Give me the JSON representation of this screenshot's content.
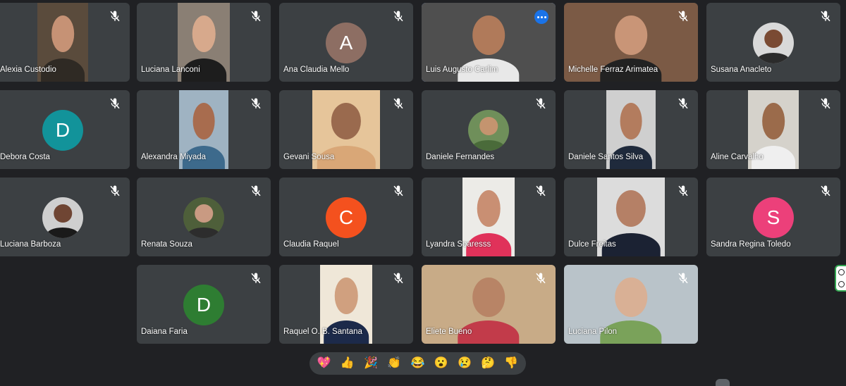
{
  "participants": [
    {
      "name": "Alexia Custodio",
      "kind": "video",
      "skin": "#c69275",
      "shirt": "#2f2a24",
      "bg": "#5a4b3c"
    },
    {
      "name": "Luciana Lanconi",
      "kind": "video",
      "skin": "#d7a98c",
      "shirt": "#1d1d1d",
      "bg": "#8a7f74"
    },
    {
      "name": "Ana Claudia Mello",
      "kind": "initial",
      "initial": "A",
      "color": "#8d6e63"
    },
    {
      "name": "Luis Augusto Carlim",
      "kind": "video",
      "skin": "#b07a5a",
      "shirt": "#e8e8e8",
      "bg": "#4f4f4f",
      "active": true
    },
    {
      "name": "Michelle Ferraz Arimatea",
      "kind": "video",
      "skin": "#c99577",
      "shirt": "#222",
      "bg": "#7b5a45"
    },
    {
      "name": "Susana Anacleto",
      "kind": "photo",
      "skin": "#7a4a33",
      "shirt": "#2b2b2b",
      "bg": "#d9d9d9"
    },
    {
      "name": "Debora Costa",
      "kind": "initial",
      "initial": "D",
      "color": "#12939a"
    },
    {
      "name": "Alexandra Miyada",
      "kind": "video",
      "skin": "#a86c4e",
      "shirt": "#3d6a8c",
      "bg": "#9fb3c2"
    },
    {
      "name": "Gevani Sousa",
      "kind": "video",
      "skin": "#9a6a4e",
      "shirt": "#d9a777",
      "bg": "#e6c59a"
    },
    {
      "name": "Daniele Fernandes",
      "kind": "photo",
      "skin": "#c4946f",
      "shirt": "#4a6b3a",
      "bg": "#6f8f5a"
    },
    {
      "name": "Daniele Santos Silva",
      "kind": "video",
      "skin": "#b37c5e",
      "shirt": "#1f2a3c",
      "bg": "#cfcfcf"
    },
    {
      "name": "Aline Carvalho",
      "kind": "video",
      "skin": "#9b6b4b",
      "shirt": "#efefef",
      "bg": "#d5d2cb"
    },
    {
      "name": "Luciana Barboza",
      "kind": "photo",
      "skin": "#6f4533",
      "shirt": "#1a1a1a",
      "bg": "#cfcfcf"
    },
    {
      "name": "Renata Souza",
      "kind": "photo",
      "skin": "#c99a82",
      "shirt": "#2d2d2d",
      "bg": "#4e5f3a"
    },
    {
      "name": "Claudia Raquel",
      "kind": "initial",
      "initial": "C",
      "color": "#f4511e"
    },
    {
      "name": "Lyandra Soaresss",
      "kind": "video",
      "skin": "#c98f73",
      "shirt": "#e0325a",
      "bg": "#ecebe7"
    },
    {
      "name": "Dulce Freitas",
      "kind": "video",
      "skin": "#b58066",
      "shirt": "#1b2233",
      "bg": "#dcdcdc"
    },
    {
      "name": "Sandra Regina Toledo",
      "kind": "initial",
      "initial": "S",
      "color": "#ec407a"
    },
    {
      "name": "Daiana Faria",
      "kind": "initial",
      "initial": "D",
      "color": "#2e7d32"
    },
    {
      "name": "Raquel O. B. Santana",
      "kind": "video",
      "skin": "#d0a07f",
      "shirt": "#1c2a4a",
      "bg": "#efe7d8"
    },
    {
      "name": "Eliete Bueno",
      "kind": "video",
      "skin": "#b88466",
      "shirt": "#c23b4a",
      "bg": "#c8ab87",
      "wide": true
    },
    {
      "name": "Luciana Pilon",
      "kind": "video",
      "skin": "#d9b095",
      "shirt": "#7aa25a",
      "bg": "#b9c3c9",
      "wide": true
    }
  ],
  "reactions": [
    "💖",
    "👍",
    "🎉",
    "👏",
    "😂",
    "😮",
    "😢",
    "🤔",
    "👎"
  ],
  "reaction_names": [
    "sparkling-heart",
    "thumbs-up",
    "party-popper",
    "clapping",
    "tears-of-joy",
    "surprised",
    "sad",
    "thinking",
    "thumbs-down"
  ]
}
